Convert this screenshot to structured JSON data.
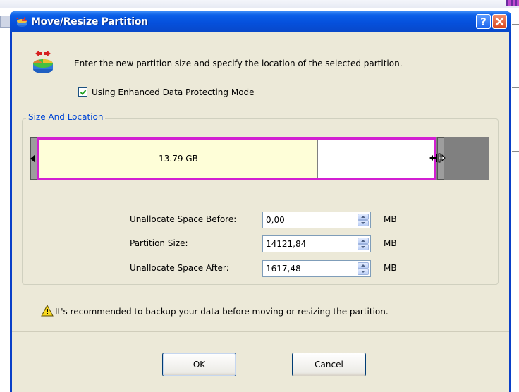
{
  "window": {
    "title": "Move/Resize Partition"
  },
  "header": {
    "instruction": "Enter the new partition size and specify the location of the selected partition."
  },
  "options": {
    "enhanced_mode_label": "Using Enhanced Data Protecting Mode",
    "enhanced_mode_checked": true
  },
  "size_location": {
    "group_label": "Size And Location",
    "partition_label": "13.79 GB",
    "fields": [
      {
        "label": "Unallocate Space Before:",
        "value": "0,00",
        "unit": "MB"
      },
      {
        "label": "Partition Size:",
        "value": "14121,84",
        "unit": "MB"
      },
      {
        "label": "Unallocate Space After:",
        "value": "1617,48",
        "unit": "MB"
      }
    ]
  },
  "warning": {
    "text": "It's recommended to backup your data before moving or resizing the partition."
  },
  "buttons": {
    "ok_label": "OK",
    "cancel_label": "Cancel"
  },
  "colors": {
    "titlebar": "#0550dc",
    "partition_border": "#d21fd2",
    "used_space": "#fefed8",
    "unallocated": "#808080"
  }
}
